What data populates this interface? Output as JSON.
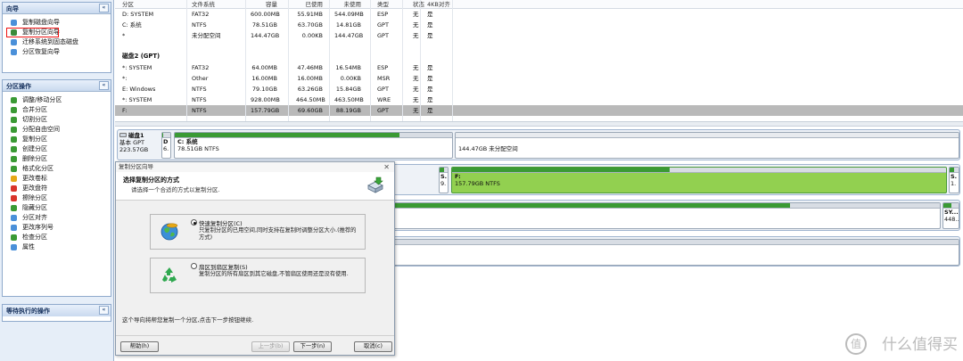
{
  "sidebar": {
    "wizard_title": "向导",
    "wizard_items": [
      {
        "label": "复制磁盘向导",
        "icon": "disk-copy-icon",
        "color": "#4a90d9"
      },
      {
        "label": "复制分区向导",
        "icon": "partition-copy-icon",
        "color": "#3a8a3a"
      },
      {
        "label": "迁移系统到固态磁盘",
        "icon": "migrate-ssd-icon",
        "color": "#4a90d9"
      },
      {
        "label": "分区恢复向导",
        "icon": "partition-recovery-icon",
        "color": "#4a90d9"
      }
    ],
    "ops_title": "分区操作",
    "ops_items": [
      {
        "label": "调整/移动分区",
        "icon": "resize-icon",
        "color": "#3a9a34"
      },
      {
        "label": "合并分区",
        "icon": "merge-icon",
        "color": "#3a9a34"
      },
      {
        "label": "切割分区",
        "icon": "split-icon",
        "color": "#3a9a34"
      },
      {
        "label": "分配自由空间",
        "icon": "allocate-icon",
        "color": "#3a9a34"
      },
      {
        "label": "复制分区",
        "icon": "copy-icon",
        "color": "#3a9a34"
      },
      {
        "label": "创建分区",
        "icon": "create-icon",
        "color": "#3a9a34"
      },
      {
        "label": "删除分区",
        "icon": "delete-icon",
        "color": "#3a9a34"
      },
      {
        "label": "格式化分区",
        "icon": "format-icon",
        "color": "#3a9a34"
      },
      {
        "label": "更改卷标",
        "icon": "label-icon",
        "color": "#e6a817"
      },
      {
        "label": "更改盘符",
        "icon": "drive-letter-icon",
        "color": "#d9342b"
      },
      {
        "label": "擦除分区",
        "icon": "wipe-icon",
        "color": "#d9342b"
      },
      {
        "label": "隐藏分区",
        "icon": "hide-icon",
        "color": "#3a9a34"
      },
      {
        "label": "分区对齐",
        "icon": "align-icon",
        "color": "#4a90d9"
      },
      {
        "label": "更改序列号",
        "icon": "serial-icon",
        "color": "#4a90d9"
      },
      {
        "label": "检查分区",
        "icon": "check-icon",
        "color": "#3a9a34"
      },
      {
        "label": "属性",
        "icon": "properties-icon",
        "color": "#4a90d9"
      }
    ],
    "pending_title": "等待执行的操作",
    "collapse_glyph": "«"
  },
  "table": {
    "headers": [
      "分区",
      "文件系统",
      "容量",
      "已使用",
      "未使用",
      "类型",
      "状态",
      "4KB对齐"
    ],
    "rows_top": [
      [
        "D: SYSTEM",
        "FAT32",
        "600.00MB",
        "55.91MB",
        "544.09MB",
        "ESP",
        "无",
        "是"
      ],
      [
        "C: 系统",
        "NTFS",
        "78.51GB",
        "63.70GB",
        "14.81GB",
        "GPT",
        "无",
        "是"
      ],
      [
        "*",
        "未分配空间",
        "144.47GB",
        "0.00KB",
        "144.47GB",
        "GPT",
        "无",
        "是"
      ]
    ],
    "disk2_title": "磁盘2 (GPT)",
    "rows_bottom": [
      [
        "*: SYSTEM",
        "FAT32",
        "64.00MB",
        "47.46MB",
        "16.54MB",
        "ESP",
        "无",
        "是"
      ],
      [
        "*:",
        "Other",
        "16.00MB",
        "16.00MB",
        "0.00KB",
        "MSR",
        "无",
        "是"
      ],
      [
        "E: Windows",
        "NTFS",
        "79.10GB",
        "63.26GB",
        "15.84GB",
        "GPT",
        "无",
        "是"
      ],
      [
        "*: SYSTEM",
        "NTFS",
        "928.00MB",
        "464.50MB",
        "463.50MB",
        "WRE",
        "无",
        "是"
      ],
      [
        "F:",
        "NTFS",
        "157.79GB",
        "69.60GB",
        "88.19GB",
        "GPT",
        "无",
        "是"
      ]
    ]
  },
  "diskmap": {
    "disk1": {
      "name": "磁盘1",
      "kind": "基本 GPT",
      "size": "223.57GB"
    },
    "d_part_label": "D",
    "d_part_sub": "6.",
    "c_part_label": "C: 系统",
    "c_part_sub": "78.51GB NTFS",
    "c_fill": 0.81,
    "unalloc_sub": "144.47GB 未分配空间",
    "s_label": "S.",
    "s_sub": "9.",
    "s_fill": 0.5,
    "f_label": "F:",
    "f_sub": "157.79GB NTFS",
    "f_fill": 0.44,
    "row2_right_label": "S.",
    "row2_right_sub": "1.",
    "row3_sy": "SY...",
    "row3_sy_sub": "448...",
    "row3_fill": 0.73
  },
  "dialog": {
    "title": "复制分区向导",
    "close": "✕",
    "heading": "选择复制分区的方式",
    "subheading": "请选择一个合适的方式以复制分区.",
    "opt1_label": "快速复制分区(C)",
    "opt1_desc": "只复制分区的已用空间,同时支持在复制时调整分区大小.(推荐的方式)",
    "opt2_label": "扇区到扇区复制(S)",
    "opt2_desc": "复制分区的所有扇区到其它磁盘,不管扇区使用还是没有使用.",
    "footer_text": "这个导向将帮您复制一个分区,点击下一步按钮继续.",
    "help_btn": "帮助(h)",
    "prev_btn": "上一步(b)",
    "next_btn": "下一步(n)",
    "cancel_btn": "取消(c)"
  },
  "watermark": {
    "logo": "值",
    "text": "什么值得买"
  }
}
